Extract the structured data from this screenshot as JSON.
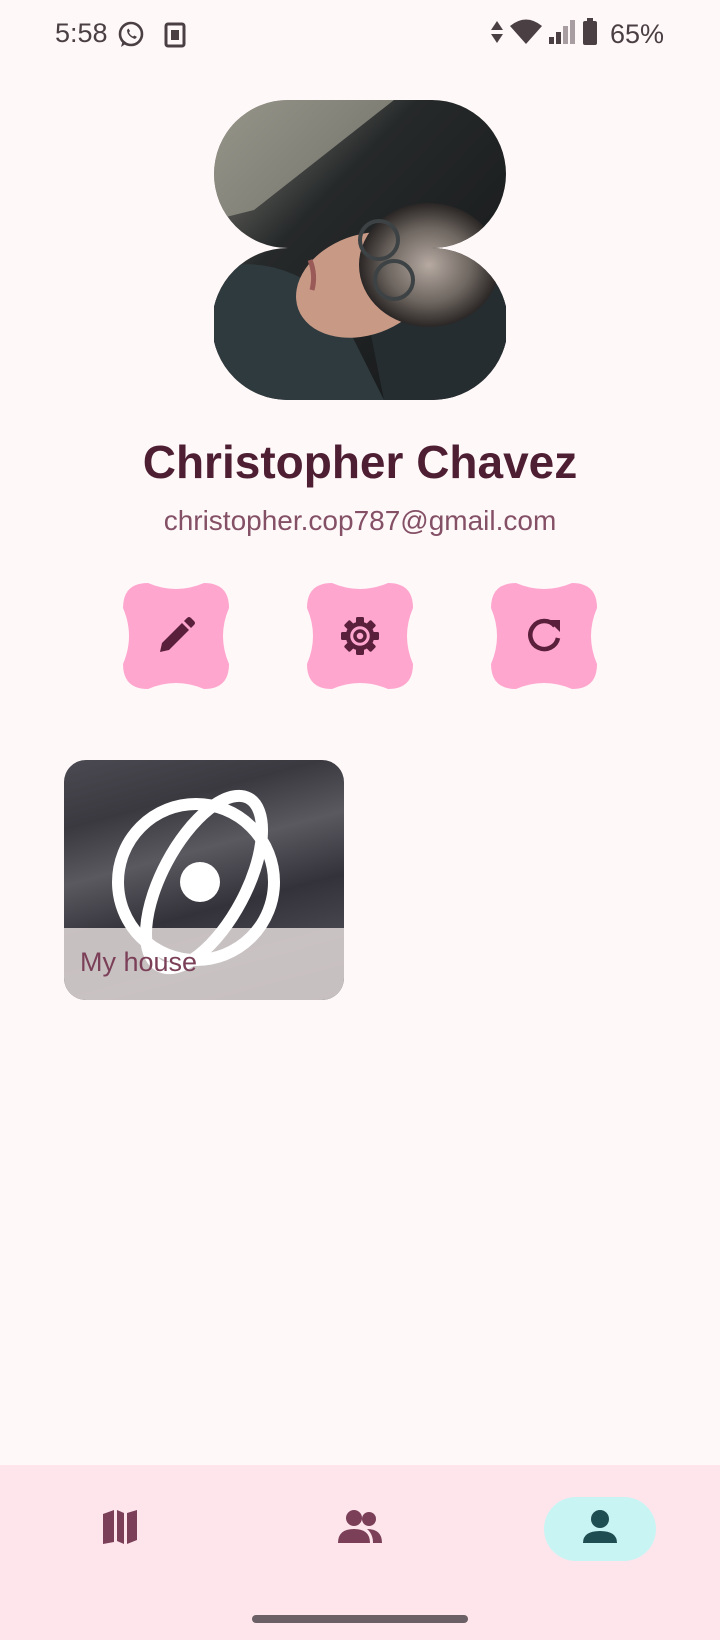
{
  "status_bar": {
    "time": "5:58",
    "battery": "65%",
    "icons": [
      "whatsapp-icon",
      "sim-card-icon",
      "data-arrows-icon",
      "wifi-icon",
      "cell-signal-icon",
      "battery-icon"
    ]
  },
  "profile": {
    "name": "Christopher Chavez",
    "email": "christopher.cop787@gmail.com"
  },
  "actions": [
    {
      "icon": "pencil-icon"
    },
    {
      "icon": "gear-icon"
    },
    {
      "icon": "refresh-icon"
    }
  ],
  "places": [
    {
      "label": "My house",
      "icon": "planet-icon"
    }
  ],
  "bottom_nav": {
    "items": [
      {
        "icon": "map-icon",
        "active": false
      },
      {
        "icon": "people-icon",
        "active": false
      },
      {
        "icon": "person-icon",
        "active": true
      }
    ]
  },
  "colors": {
    "background": "#fff8f8",
    "name": "#4e1f33",
    "email": "#845066",
    "action_button": "#ffa6cf",
    "action_icon": "#5a1f3a",
    "nav_bar": "#fde5eb",
    "nav_active": "#c9f4f4"
  }
}
